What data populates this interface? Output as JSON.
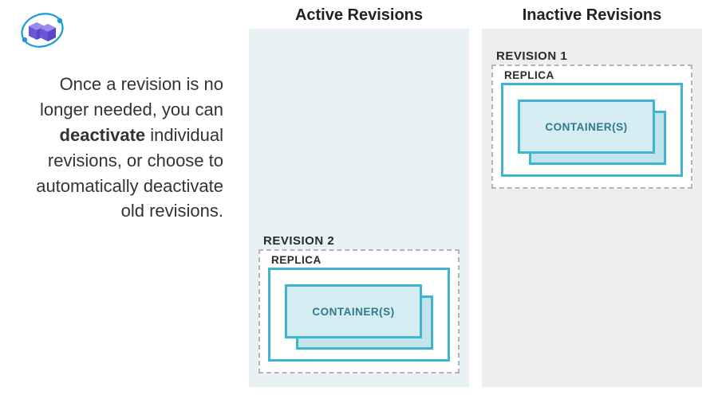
{
  "sidebar": {
    "text_pre": "Once a revision is no longer needed, you can ",
    "text_bold": "deactivate",
    "text_post": " individual revisions, or choose to automatically deactivate old revisions."
  },
  "columns": {
    "active": {
      "title": "Active Revisions",
      "revision": {
        "label": "REVISION 2",
        "replica_label": "REPLICA",
        "container_label": "CONTAINER(S)"
      }
    },
    "inactive": {
      "title": "Inactive Revisions",
      "revision": {
        "label": "REVISION 1",
        "replica_label": "REPLICA",
        "container_label": "CONTAINER(S)"
      }
    }
  },
  "colors": {
    "teal_border": "#3fb6cf",
    "teal_fill": "#d5edf2",
    "active_bg": "#e8f2f5",
    "inactive_bg": "#eeeeee"
  }
}
